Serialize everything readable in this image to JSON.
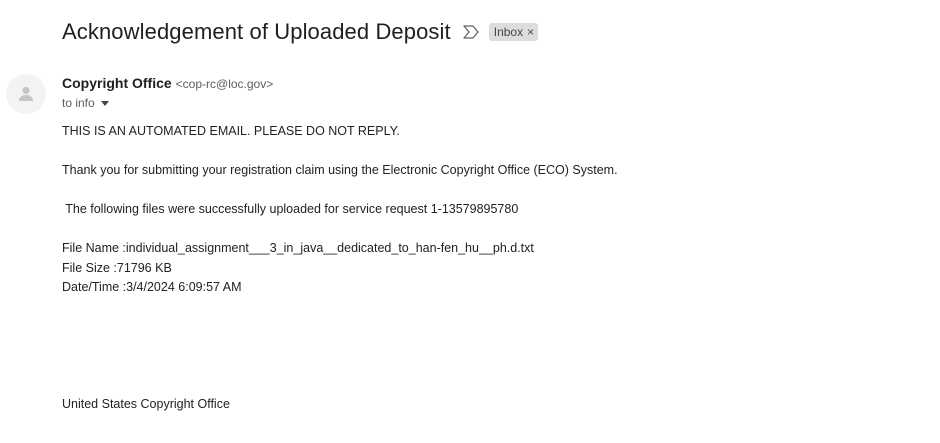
{
  "email": {
    "subject": "Acknowledgement of Uploaded Deposit",
    "label": "Inbox",
    "label_close": "×",
    "sender_name": "Copyright Office",
    "sender_email": "<cop-rc@loc.gov>",
    "recipient": "to info",
    "body": {
      "line1": "THIS IS AN AUTOMATED EMAIL. PLEASE DO NOT REPLY.",
      "line2": "Thank you for submitting your registration claim using the Electronic Copyright Office (ECO) System.",
      "line3": " The following files were successfully uploaded for service request 1-13579895780",
      "file_name": "File Name :individual_assignment___3_in_java__dedicated_to_han-fen_hu__ph.d.txt",
      "file_size": "File Size :71796 KB",
      "date_time": "Date/Time :3/4/2024 6:09:57 AM",
      "signature": "United States Copyright Office"
    }
  },
  "icons": {
    "importance": "importance-marker-icon",
    "avatar": "person-icon",
    "caret": "chevron-down-icon"
  },
  "colors": {
    "chip_bg": "#dddddd",
    "avatar_bg": "#f1f3f4"
  }
}
